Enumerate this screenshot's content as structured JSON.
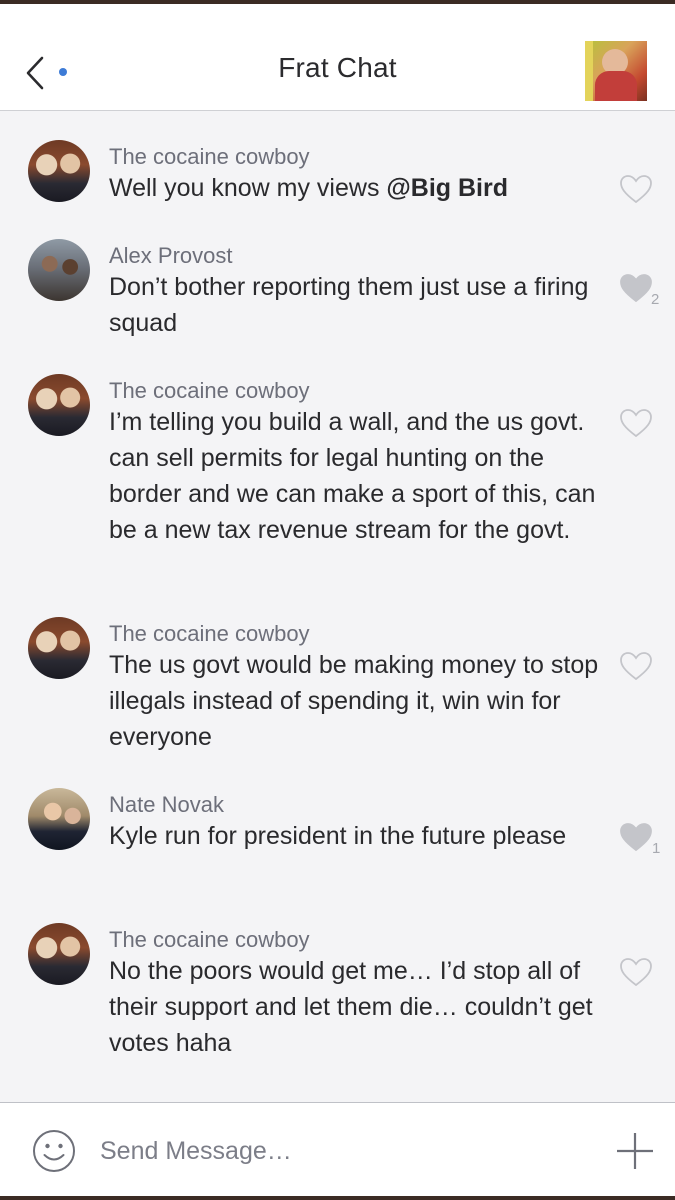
{
  "header": {
    "title": "Frat Chat",
    "back_icon": "chevron-left-icon",
    "accent_color": "#3d7bd6"
  },
  "messages": [
    {
      "sender": "The cocaine cowboy",
      "text_prefix": "Well you know my views ",
      "mention": "@Big Bird",
      "likes": "",
      "liked": false
    },
    {
      "sender": "Alex Provost",
      "text": "Don’t bother reporting them just use a firing squad",
      "likes": "2",
      "liked": true
    },
    {
      "sender": "The cocaine cowboy",
      "text": "I’m telling you build a wall, and the us govt. can sell permits for legal hunting on the border and we can make a sport of this, can be a new tax revenue stream for the govt.",
      "likes": "",
      "liked": false
    },
    {
      "sender": "The cocaine cowboy",
      "text": "The us govt would be making money to stop illegals instead of spending it, win win for everyone",
      "likes": "",
      "liked": false
    },
    {
      "sender": "Nate Novak",
      "text": "Kyle run for president in the future please",
      "likes": "1",
      "liked": true
    },
    {
      "sender": "The cocaine cowboy",
      "text": "No the poors would get me… I’d stop all of their support and let them die… couldn’t get votes haha",
      "likes": "",
      "liked": false
    }
  ],
  "composer": {
    "placeholder": "Send Message…",
    "emoji_icon": "smiley-icon",
    "plus_icon": "plus-icon"
  }
}
